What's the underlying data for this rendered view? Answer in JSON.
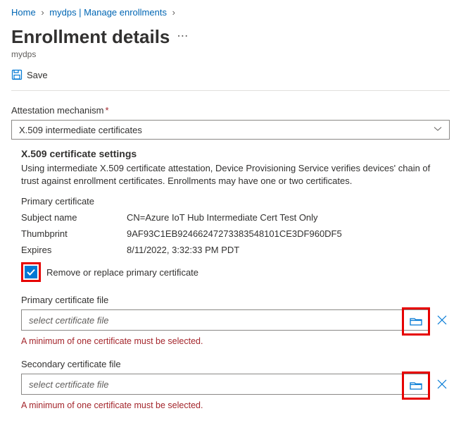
{
  "breadcrumb": {
    "home": "Home",
    "item2": "mydps | Manage enrollments"
  },
  "page": {
    "title": "Enrollment details",
    "subtitle": "mydps"
  },
  "toolbar": {
    "save_label": "Save"
  },
  "form": {
    "attestation_label": "Attestation mechanism",
    "attestation_value": "X.509 intermediate certificates",
    "x509": {
      "heading": "X.509 certificate settings",
      "description": "Using intermediate X.509 certificate attestation, Device Provisioning Service verifies devices' chain of trust against enrollment certificates. Enrollments may have one or two certificates.",
      "primary_heading": "Primary certificate",
      "rows": {
        "subject_label": "Subject name",
        "subject_value": "CN=Azure IoT Hub Intermediate Cert Test Only",
        "thumbprint_label": "Thumbprint",
        "thumbprint_value": "9AF93C1EB92466247273383548101CE3DF960DF5",
        "expires_label": "Expires",
        "expires_value": "8/11/2022, 3:32:33 PM PDT"
      },
      "remove_replace_label": "Remove or replace primary certificate",
      "primary_file_label": "Primary certificate file",
      "primary_file_placeholder": "select certificate file",
      "primary_error": "A minimum of one certificate must be selected.",
      "secondary_file_label": "Secondary certificate file",
      "secondary_file_placeholder": "select certificate file",
      "secondary_error": "A minimum of one certificate must be selected."
    }
  }
}
